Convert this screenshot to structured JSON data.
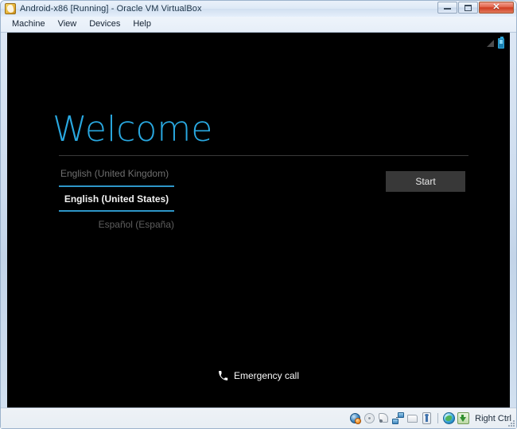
{
  "window": {
    "title": "Android-x86 [Running] - Oracle VM VirtualBox",
    "app_icon": "virtualbox-icon",
    "buttons": {
      "minimize": "minimize-button",
      "maximize": "maximize-button",
      "close_glyph": "✕"
    }
  },
  "menu": {
    "items": [
      {
        "label": "Machine"
      },
      {
        "label": "View"
      },
      {
        "label": "Devices"
      },
      {
        "label": "Help"
      }
    ]
  },
  "android": {
    "status_bar": {
      "signal_icon": "signal-strength-icon",
      "battery_icon": "battery-icon"
    },
    "welcome": {
      "heading": "Welcome",
      "accent_color": "#29a8e0"
    },
    "language_picker": {
      "previous": "English (United Kingdom)",
      "selected": "English (United States)",
      "next": "Español (España)",
      "underline_color": "#2e96c8"
    },
    "start_button": {
      "label": "Start",
      "background": "#383838"
    },
    "emergency_call": {
      "label": "Emergency call",
      "icon": "phone-icon"
    }
  },
  "status_bar": {
    "icons": [
      {
        "name": "hard-disk-icon"
      },
      {
        "name": "optical-disk-icon"
      },
      {
        "name": "floppy-disk-icon"
      },
      {
        "name": "network-adapter-icon"
      },
      {
        "name": "shared-folders-icon"
      },
      {
        "name": "usb-devices-icon"
      },
      {
        "name": "remote-desktop-icon"
      },
      {
        "name": "host-key-icon"
      }
    ],
    "host_key_label": "Right Ctrl"
  }
}
